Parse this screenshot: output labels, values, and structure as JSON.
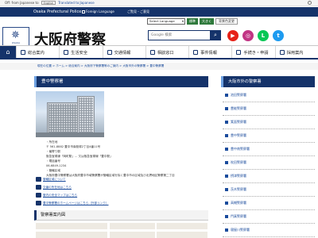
{
  "topbar": {
    "language_label": "English",
    "translation_note": "Translated to:Japanese",
    "lang_prefix": "Off: from Japanese to"
  },
  "header": {
    "org_english": "Osaka Prefectural Police",
    "foreign_language": "Foreign Language",
    "accessibility_note": "ご覧見・ご意見",
    "select_language": "Select Language",
    "btn_normal": "標準",
    "btn_large": "大きく",
    "btn_color": "背景色変更",
    "site_title": "大阪府警察",
    "logo_caption": "OSAKA",
    "search_placeholder": "Google 検索",
    "search_icon": "search-icon"
  },
  "social": [
    {
      "name": "youtube-icon",
      "color": "#e62117",
      "glyph": "▶"
    },
    {
      "name": "instagram-icon",
      "color": "#c13584",
      "glyph": "◎"
    },
    {
      "name": "line-icon",
      "color": "#06c755",
      "glyph": "L"
    },
    {
      "name": "twitter-icon",
      "color": "#1d9bf0",
      "glyph": "t"
    }
  ],
  "gnav": {
    "home_icon": "home-icon",
    "items": [
      "総合案内",
      "生活安全",
      "交通情報",
      "相談窓口",
      "事件情報",
      "手続き・申請",
      "採用案内"
    ]
  },
  "breadcrumb": "現在の位置 > ホーム > 総合案内 > 大阪府下警察署等のご案内 > 大阪市外の警察署 > 豊中警察署",
  "page": {
    "heading": "豊中警察署",
    "info": [
      "・所在地",
      "〒 561-8882 豊中市南桜塚2丁目4番11号",
      "・最寄り駅",
      "阪急宝塚線「岡町駅」... 又は阪急宝塚線「豊中駅」",
      "・電話番号",
      "06-6849-1234",
      "・管轄区域",
      "大阪府豊中警察署は大阪府豊中市域警察署が管轄区域を除く豊中市の区域及び北摂地区警察第二丁目"
    ],
    "links": [
      "管轄区域について",
      "交番の所在地はこちら",
      "管内の安全マップはこちら",
      "豊中警察署のホームページはこちら（外部リンク）"
    ],
    "subhead": "警察署案内図"
  },
  "sidebar": {
    "heading": "大阪市外の警察署",
    "items": [
      "池田警察署",
      "豊能警察署",
      "箕面警察署",
      "豊中警察署",
      "豊中南警察署",
      "吹田警察署",
      "摂津警察署",
      "茨木警察署",
      "高槻警察署",
      "門真警察署",
      "寝屋川警察署",
      "枚方警察署"
    ]
  },
  "colors": {
    "navy": "#15336a",
    "accent": "#6da0e0",
    "link": "#1a4b9c"
  }
}
